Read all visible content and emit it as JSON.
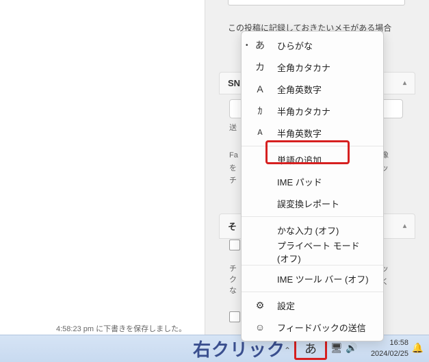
{
  "page": {
    "memo_text": "この投稿に記録しておきたいメモがある場合",
    "draft_saved": "4:58:23 pm に下書きを保存しました。"
  },
  "panels": {
    "sn_header": "SN",
    "other_header": "そ",
    "select_stub": "送",
    "fb_lines": "Fa\nを\nチ",
    "check_line": "チ\nク\nな"
  },
  "ime_menu": {
    "items": [
      {
        "glyph": "あ",
        "label": "ひらがな",
        "checked": true
      },
      {
        "glyph": "カ",
        "label": "全角カタカナ",
        "checked": false
      },
      {
        "glyph": "A",
        "label": "全角英数字",
        "checked": false
      },
      {
        "glyph": "ｶ",
        "label": "半角カタカナ",
        "checked": false
      },
      {
        "glyph": "A",
        "label": "半角英数字",
        "checked": false
      }
    ],
    "tools": [
      "単語の追加",
      "IME パッド",
      "誤変換レポート"
    ],
    "toggles": [
      "かな入力 (オフ)",
      "プライベート モード (オフ)"
    ],
    "toolbar": "IME ツール バー (オフ)",
    "settings": "設定",
    "feedback": "フィードバックの送信"
  },
  "content_trail": {
    "img_text": "像\nッ",
    "check_text2": "ッ\nく"
  },
  "taskbar": {
    "label": "右クリック",
    "ime_char": "あ",
    "time": "16:58",
    "date": "2024/02/25"
  }
}
